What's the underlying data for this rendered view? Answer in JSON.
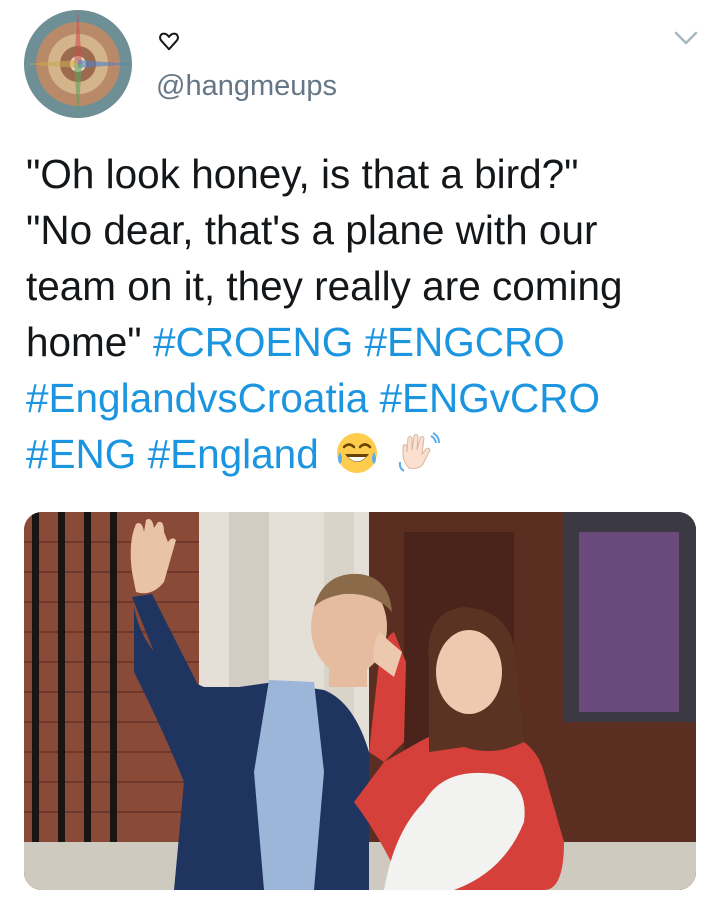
{
  "user": {
    "handle": "@hangmeups",
    "display_name_icon": "heart-outline-icon",
    "menu_icon": "chevron-down-icon"
  },
  "tweet": {
    "line1": "\"Oh look honey, is that a bird?\"",
    "line2": "\"No dear, that's a plane with our",
    "line3": "team on it, they really are coming",
    "line4_text": "home\"",
    "hashtags": [
      "#CROENG",
      "#ENGCRO",
      "#EnglandvsCroatia",
      "#ENGvCRO",
      "#ENG",
      "#England"
    ],
    "emojis": [
      "tears-of-joy-emoji",
      "waving-hand-emoji"
    ]
  },
  "colors": {
    "link": "#1b95e0",
    "text": "#14171a",
    "secondary": "#657786"
  }
}
